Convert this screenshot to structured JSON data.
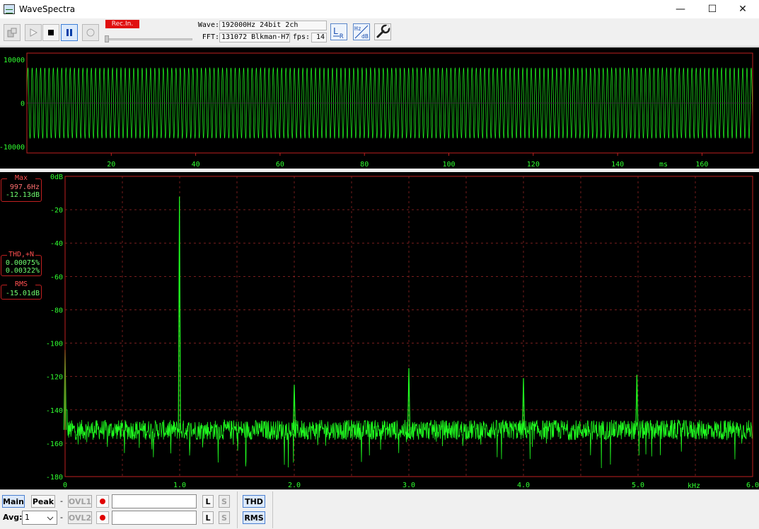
{
  "window": {
    "title": "WaveSpectra",
    "controls": {
      "minimize": "—",
      "maximize": "☐",
      "close": "✕"
    }
  },
  "toolbar": {
    "rec_label": "Rec.In.",
    "wave_label": "Wave:",
    "wave_value": "192000Hz 24bit 2ch",
    "fft_label": "FFT:",
    "fft_value": "131072 Blkman-H7",
    "fps_label": "fps:",
    "fps_value": "14",
    "buttons": [
      {
        "name": "device-icon",
        "state": "disabled"
      },
      {
        "name": "play-icon",
        "state": "disabled"
      },
      {
        "name": "stop-icon",
        "state": "enabled"
      },
      {
        "name": "pause-icon",
        "state": "active"
      },
      {
        "name": "record-icon",
        "state": "disabled"
      }
    ],
    "lr_icon": {
      "top": "L",
      "bottom": "R"
    },
    "hzdb_icon": {
      "top": "Hz",
      "bottom": "dB"
    },
    "settings_icon": "wrench-icon"
  },
  "waveform": {
    "y_ticks": [
      "10000",
      "0",
      "-10000"
    ],
    "x_ticks": [
      "20",
      "40",
      "60",
      "80",
      "100",
      "120",
      "140",
      "160"
    ],
    "x_unit": "ms",
    "trace_color": "#20ff20",
    "frame_color": "#c02020"
  },
  "spectrum": {
    "y_ticks": [
      "0dB",
      "-20",
      "-40",
      "-60",
      "-80",
      "-100",
      "-120",
      "-140",
      "-160",
      "-180"
    ],
    "x_ticks": [
      "0",
      "1.0",
      "2.0",
      "3.0",
      "4.0",
      "5.0",
      "6.0"
    ],
    "x_unit": "kHz",
    "trace_color": "#20ff20",
    "grid_color": "#c03030"
  },
  "chart_data": [
    {
      "type": "line",
      "title": "",
      "xlabel": "ms",
      "ylabel": "",
      "xlim": [
        0,
        172
      ],
      "ylim": [
        -11500,
        11500
      ],
      "series": [
        {
          "name": "",
          "frequency_hz": 997.6,
          "amplitude": 8100,
          "note": "sine waveform, ~172 cycles"
        }
      ]
    },
    {
      "type": "line",
      "title": "",
      "xlabel": "kHz",
      "ylabel": "dB",
      "xlim": [
        0,
        6.0
      ],
      "ylim": [
        -180,
        0
      ],
      "noise_floor_db": -152,
      "peaks": [
        {
          "x": 0.0,
          "y": -104
        },
        {
          "x": 0.998,
          "y": -12.13
        },
        {
          "x": 2.0,
          "y": -125
        },
        {
          "x": 3.0,
          "y": -115
        },
        {
          "x": 4.0,
          "y": -121
        },
        {
          "x": 4.99,
          "y": -119
        }
      ]
    }
  ],
  "readouts": {
    "max": {
      "head": "Max",
      "freq": "997.6Hz",
      "level": "-12.13dB"
    },
    "thd": {
      "head": "THD,+N",
      "thd": "0.00075%",
      "thdn": "0.00322%"
    },
    "rms": {
      "head": "RMS",
      "level": "-15.01dB"
    }
  },
  "bottom": {
    "main_label": "Main",
    "peak_label": "Peak",
    "dash": "-",
    "ovl1_label": "OVL1",
    "ovl2_label": "OVL2",
    "l_label": "L",
    "s_label": "S",
    "avg_label": "Avg:",
    "avg_value": "1",
    "thd_label": "THD",
    "rms_label": "RMS"
  }
}
